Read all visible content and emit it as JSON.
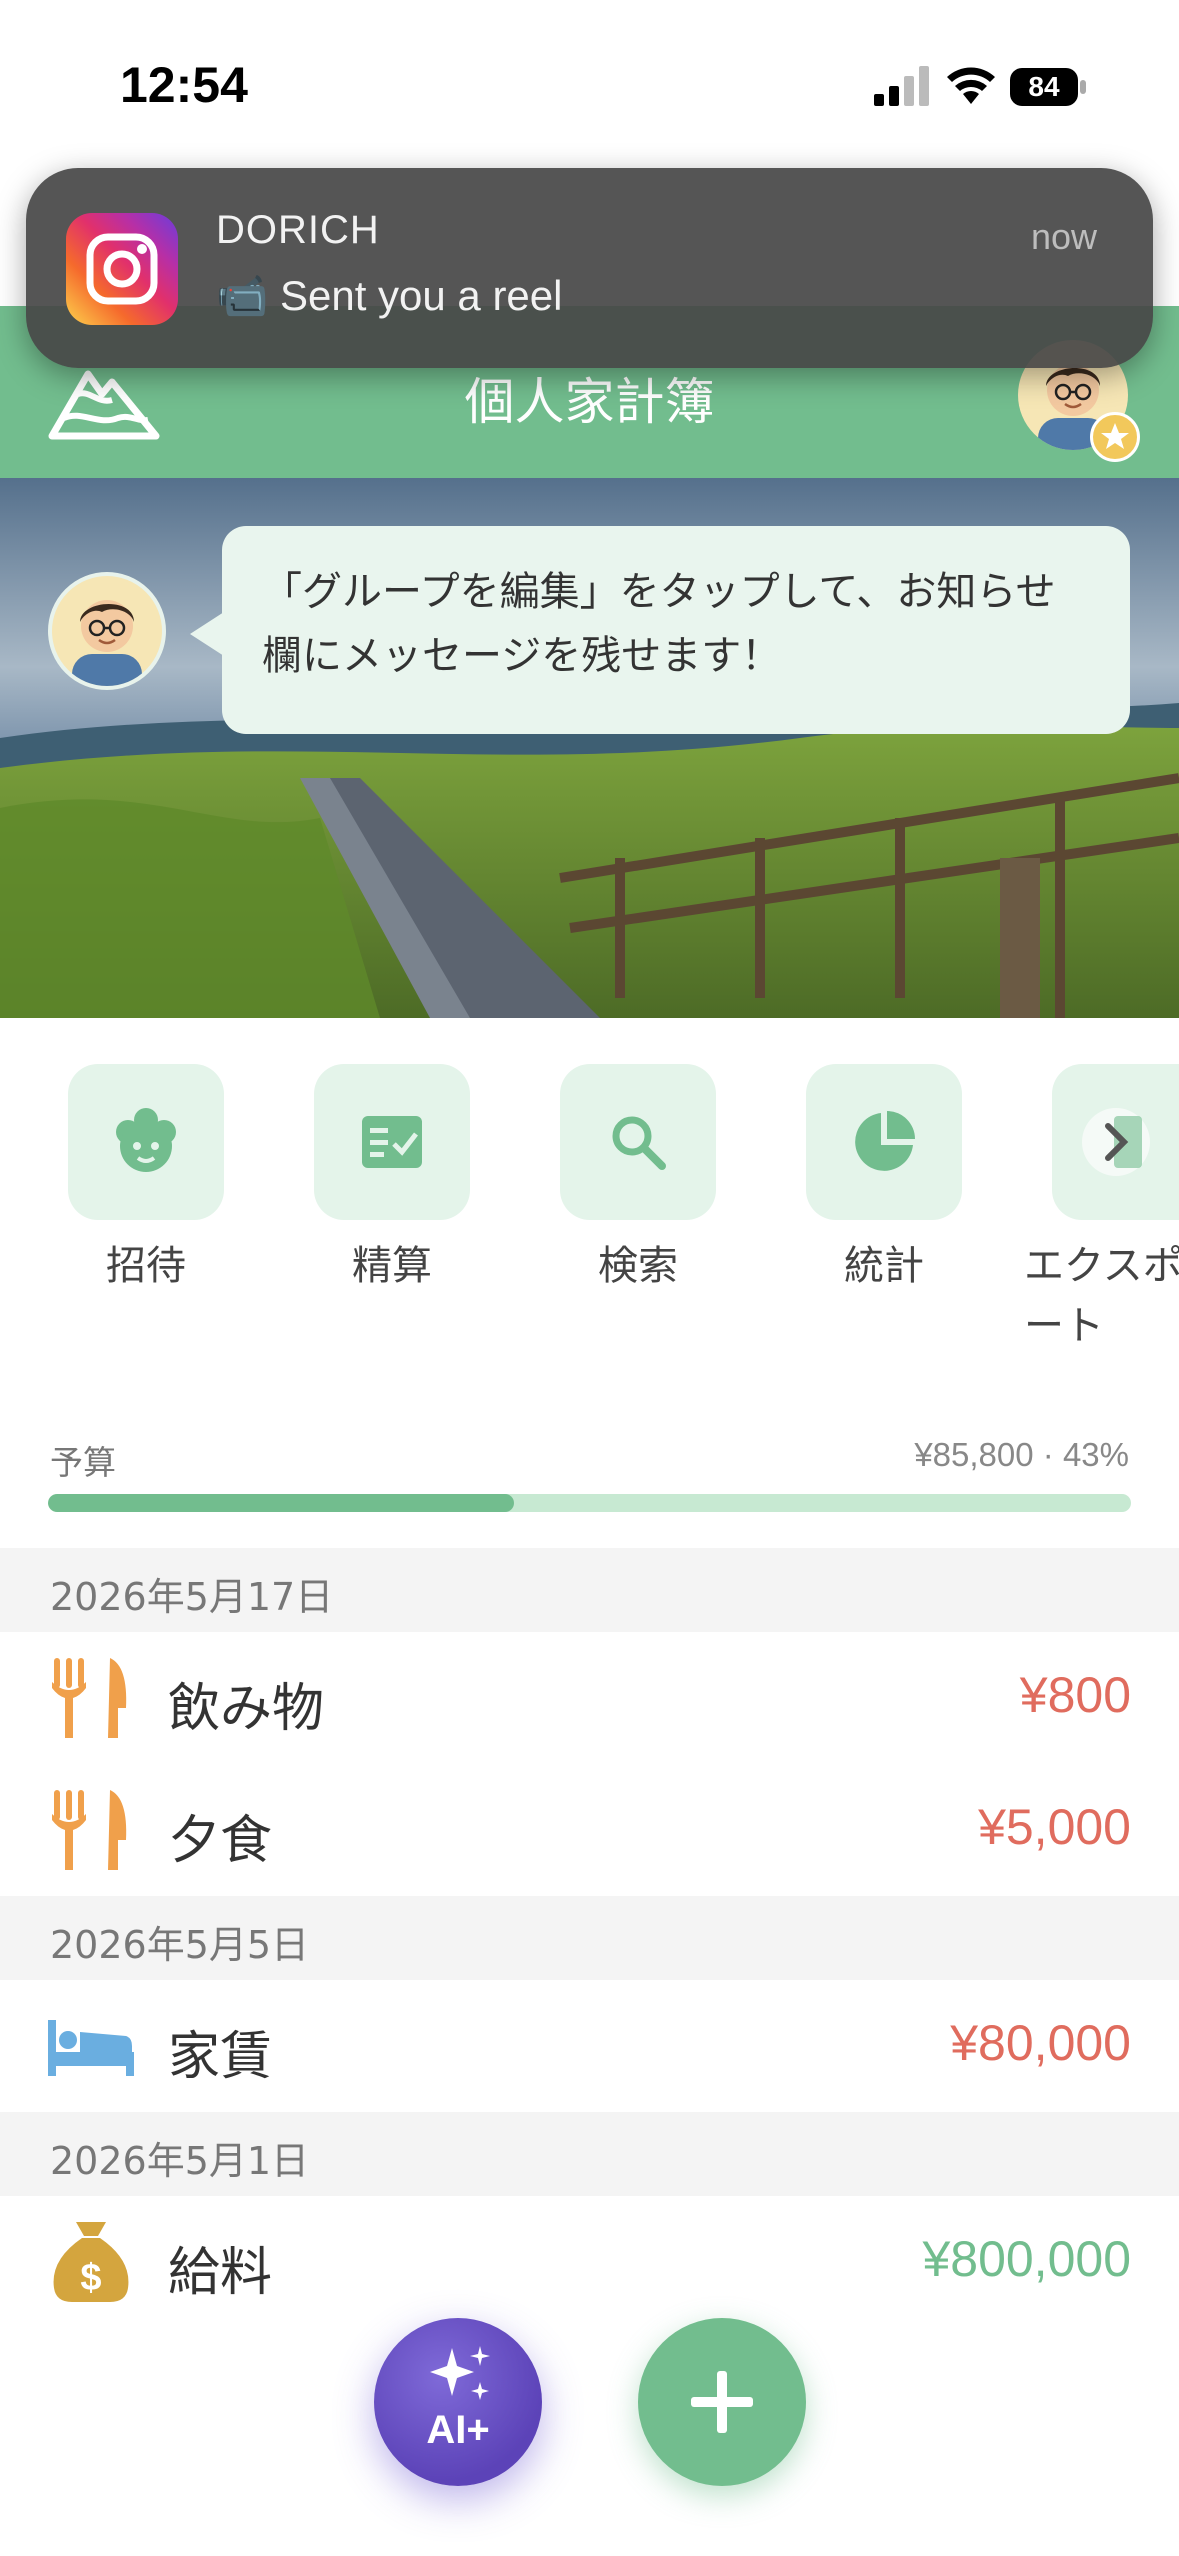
{
  "status_bar": {
    "time": "12:54",
    "battery": "84"
  },
  "notification": {
    "app": "Instagram",
    "title": "DORICH",
    "message": "📹 Sent you a reel",
    "time": "now"
  },
  "header": {
    "title": "個人家計簿"
  },
  "tip_bubble": {
    "text": "「グループを編集」をタップして、お知らせ欄にメッセージを残せます！"
  },
  "quick_actions": [
    {
      "label": "招待",
      "icon": "invite-icon"
    },
    {
      "label": "精算",
      "icon": "settlement-icon"
    },
    {
      "label": "検索",
      "icon": "search-icon"
    },
    {
      "label": "統計",
      "icon": "pie-chart-icon"
    },
    {
      "label": "エクスポート",
      "icon": "export-icon"
    }
  ],
  "budget": {
    "label": "予算",
    "value": "¥85,800 · 43%",
    "fraction": 0.43
  },
  "transactions": [
    {
      "date": "2026年5月17日",
      "items": [
        {
          "name": "飲み物",
          "amount": "¥800",
          "icon": "fork-knife-icon"
        },
        {
          "name": "夕食",
          "amount": "¥5,000",
          "icon": "fork-knife-icon"
        }
      ]
    },
    {
      "date": "2026年5月5日",
      "items": [
        {
          "name": "家賃",
          "amount": "¥80,000",
          "icon": "bed-icon"
        }
      ]
    },
    {
      "date": "2026年5月1日",
      "items": [
        {
          "name": "給料",
          "amount": "¥800,000",
          "icon": "money-bag-icon"
        }
      ]
    }
  ],
  "fab": {
    "ai_label": "AI+"
  },
  "colors": {
    "accent": "#72bd8e",
    "expense": "#e06c5e",
    "income": "#72bd8e",
    "food": "#f0a04b",
    "rent": "#6aaee0",
    "salary": "#d4a53e"
  }
}
